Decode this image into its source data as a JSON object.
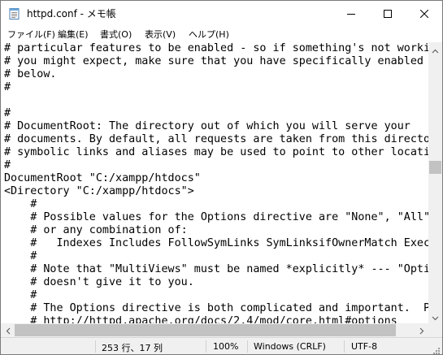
{
  "window": {
    "title": "httpd.conf - メモ帳"
  },
  "icons": {
    "app": "notepad-icon",
    "minimize": "minimize-icon",
    "maximize": "maximize-icon",
    "close": "close-icon"
  },
  "menu": [
    {
      "label": "ファイル(F)"
    },
    {
      "label": "編集(E)"
    },
    {
      "label": "書式(O)"
    },
    {
      "label": "表示(V)"
    },
    {
      "label": "ヘルプ(H)"
    }
  ],
  "editor": {
    "lines": [
      "# particular features to be enabled - so if something's not working as",
      "# you might expect, make sure that you have specifically enabled it",
      "# below.",
      "#",
      "",
      "#",
      "# DocumentRoot: The directory out of which you will serve your",
      "# documents. By default, all requests are taken from this directory, but",
      "# symbolic links and aliases may be used to point to other locations.",
      "#",
      "DocumentRoot \"C:/xampp/htdocs\"",
      "<Directory \"C:/xampp/htdocs\">",
      "    #",
      "    # Possible values for the Options directive are \"None\", \"All\",",
      "    # or any combination of:",
      "    #   Indexes Includes FollowSymLinks SymLinksifOwnerMatch ExecCGI MultiViews",
      "    #",
      "    # Note that \"MultiViews\" must be named *explicitly* --- \"Options All\"",
      "    # doesn't give it to you.",
      "    #",
      "    # The Options directive is both complicated and important.  Please see",
      "    # http://httpd.apache.org/docs/2.4/mod/core.html#options"
    ]
  },
  "status": {
    "position": "253 行、17 列",
    "zoom": "100%",
    "line_ending": "Windows (CRLF)",
    "encoding": "UTF-8"
  }
}
